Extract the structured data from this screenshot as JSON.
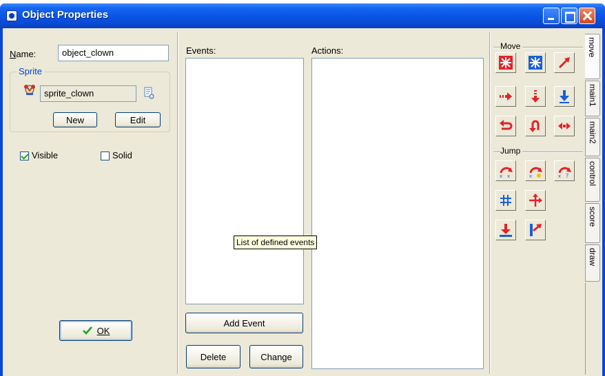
{
  "window": {
    "title": "Object Properties"
  },
  "props": {
    "name_label": "Name:",
    "name_value": "object_clown",
    "sprite_group_title": "Sprite",
    "sprite_value": "sprite_clown",
    "new_label": "New",
    "edit_label": "Edit",
    "visible_label": "Visible",
    "visible_checked": true,
    "solid_label": "Solid",
    "solid_checked": false,
    "ok_label": "OK"
  },
  "events": {
    "title": "Events:",
    "add_label": "Add Event",
    "delete_label": "Delete",
    "change_label": "Change",
    "tooltip": "List of defined events"
  },
  "actions": {
    "title": "Actions:"
  },
  "library": {
    "move_section": "Move",
    "jump_section": "Jump",
    "tabs": [
      "move",
      "main1",
      "main2",
      "control",
      "score",
      "draw"
    ],
    "active_tab": "move"
  },
  "colors": {
    "titlebar": "#0a46d6",
    "dialog_bg": "#ece9d8",
    "group_title": "#0046d5",
    "action_red": "#e3222a",
    "action_blue": "#1a5fd4"
  }
}
